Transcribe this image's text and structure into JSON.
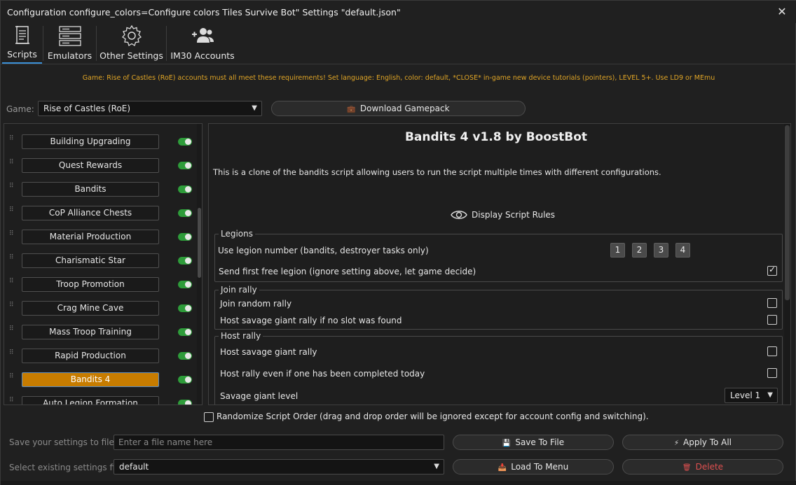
{
  "window": {
    "title": "Configuration configure_colors=Configure colors Tiles Survive Bot\" Settings \"default.json\"",
    "close_icon": "close-icon"
  },
  "tabs": [
    {
      "label": "Scripts",
      "icon": "scroll-icon",
      "active": true
    },
    {
      "label": "Emulators",
      "icon": "server-stack-icon",
      "active": false
    },
    {
      "label": "Other Settings",
      "icon": "gear-icon",
      "active": false
    },
    {
      "label": "IM30 Accounts",
      "icon": "add-users-icon",
      "active": false
    }
  ],
  "notice": "Game: Rise of Castles (RoE) accounts must all meet these requirements! Set language: English, color: default, *CLOSE* in-game new device tutorials (pointers), LEVEL 5+. Use LD9 or MEmu",
  "game": {
    "label": "Game:",
    "selected": "Rise of Castles (RoE)",
    "download_label": "Download Gamepack",
    "download_icon": "briefcase-icon"
  },
  "scripts": [
    {
      "label": "Building Upgrading",
      "enabled": true,
      "active": false
    },
    {
      "label": "Quest Rewards",
      "enabled": true,
      "active": false
    },
    {
      "label": "Bandits",
      "enabled": true,
      "active": false
    },
    {
      "label": "CoP Alliance Chests",
      "enabled": true,
      "active": false
    },
    {
      "label": "Material Production",
      "enabled": true,
      "active": false
    },
    {
      "label": "Charismatic Star",
      "enabled": true,
      "active": false
    },
    {
      "label": "Troop Promotion",
      "enabled": true,
      "active": false
    },
    {
      "label": "Crag Mine Cave",
      "enabled": true,
      "active": false
    },
    {
      "label": "Mass Troop Training",
      "enabled": true,
      "active": false
    },
    {
      "label": "Rapid Production",
      "enabled": true,
      "active": false
    },
    {
      "label": "Bandits 4",
      "enabled": true,
      "active": true
    },
    {
      "label": "Auto Legion Formation",
      "enabled": true,
      "active": false
    }
  ],
  "script_detail": {
    "title": "Bandits 4 v1.8 by BoostBot",
    "description": "This is a clone of the bandits script allowing users to run the script multiple times with different configurations.",
    "rules_label": "Display Script Rules",
    "groups": {
      "legions": {
        "title": "Legions",
        "use_legion_label": "Use legion number (bandits, destroyer tasks only)",
        "legion_numbers": [
          "1",
          "2",
          "3",
          "4"
        ],
        "first_free_label": "Send first free legion (ignore setting above, let game decide)",
        "first_free_checked": true
      },
      "join_rally": {
        "title": "Join rally",
        "join_random_label": "Join random rally",
        "join_random_checked": false,
        "host_if_no_slot_label": "Host savage giant rally if no slot was found",
        "host_if_no_slot_checked": false
      },
      "host_rally": {
        "title": "Host rally",
        "host_savage_label": "Host savage giant rally",
        "host_savage_checked": false,
        "host_even_label": "Host rally even if one has been completed today",
        "host_even_checked": false,
        "level_label": "Savage giant level",
        "level_value": "Level 1"
      }
    }
  },
  "randomize": {
    "label": "Randomize Script Order (drag and drop order will be ignored except for account config and switching).",
    "checked": false
  },
  "save_row": {
    "label": "Save your settings to file",
    "placeholder": "Enter a file name here",
    "save_label": "Save To File",
    "apply_label": "Apply To All"
  },
  "load_row": {
    "label": "Select existing settings file",
    "selected": "default",
    "load_label": "Load To Menu",
    "delete_label": "Delete"
  },
  "colors": {
    "accent": "#3a8fd6",
    "active_script": "#c77c00",
    "toggle_on": "#2e9c3a",
    "notice": "#e0a526",
    "delete": "#e05050"
  }
}
